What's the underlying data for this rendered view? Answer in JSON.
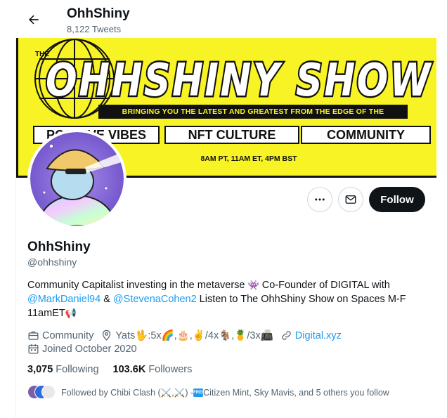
{
  "header": {
    "title": "OhhShiny",
    "tweet_count": "8,122 Tweets"
  },
  "banner": {
    "small_label": "THE",
    "show_title": "OHHSHINY SHOW",
    "tagline": "BRINGING YOU THE LATEST AND GREATEST FROM THE EDGE OF THE METAVERSE",
    "pills": [
      "POSITIVE VIBES",
      "NFT CULTURE",
      "COMMUNITY"
    ],
    "times": "8AM PT, 11AM ET, 4PM BST",
    "bg_color": "#f7f324"
  },
  "actions": {
    "more_icon": "more-icon",
    "message_icon": "mail-icon",
    "follow_label": "Follow"
  },
  "profile": {
    "name": "OhhShiny",
    "handle": "@ohhshiny",
    "bio": {
      "part1": "Community Capitalist investing in the metaverse ",
      "emoji_alien": "👾",
      "part2": " Co-Founder of DIGITAL with ",
      "mention1": "@MarkDaniel94",
      "amp": " & ",
      "mention2": "@StevenaCohen2",
      "part3": " Listen to The OhhShiny Show on Spaces M-F 11amET",
      "emoji_megaphone": "📢"
    },
    "category": "Community",
    "location": "Yats🖖:5x🌈,🎂,✌️/4x🐐,🍍/3x📠",
    "website": "Digital.xyz",
    "joined": "Joined October 2020"
  },
  "stats": {
    "following_count": "3,075",
    "following_label": "Following",
    "followers_count": "103.6K",
    "followers_label": "Followers"
  },
  "followed_by": {
    "prefix": "Followed by Chibi Clash (⚔️,⚔️) - ",
    "badge": "FREE",
    "suffix": " Citizen Mint, Sky Mavis, and 5 others you follow"
  },
  "colors": {
    "link": "#1d9bf0",
    "secondary_text": "#536471",
    "follow_button": "#0f1419"
  }
}
